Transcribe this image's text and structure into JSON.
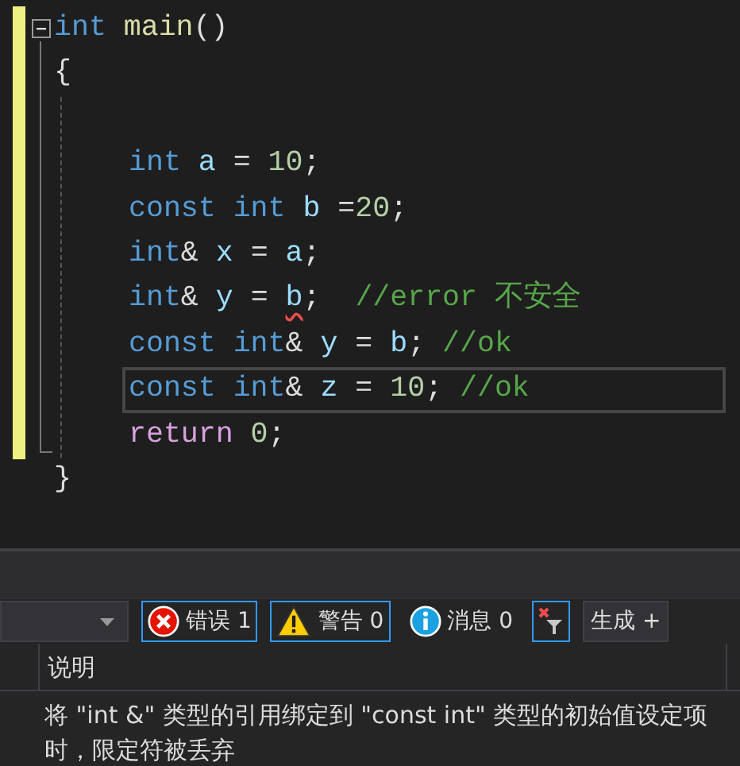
{
  "editor": {
    "lines": [
      {
        "kind": "code",
        "collapsible": true,
        "current": false,
        "tokens": [
          {
            "kind": "keyword",
            "text": "int"
          },
          {
            "kind": "function",
            "text": " main"
          },
          {
            "kind": "plain",
            "text": "()"
          }
        ]
      },
      {
        "kind": "code",
        "collapsible": false,
        "current": false,
        "tokens": [
          {
            "kind": "plain",
            "text": "{"
          }
        ],
        "children": [
          {
            "kind": "blank"
          },
          {
            "kind": "code",
            "collapsible": false,
            "current": false,
            "tokens": [
              {
                "kind": "keyword",
                "text": "int"
              },
              {
                "kind": "identifier",
                "text": " a"
              },
              {
                "kind": "plain",
                "text": " = "
              },
              {
                "kind": "number",
                "text": "10"
              },
              {
                "kind": "plain",
                "text": ";"
              }
            ]
          },
          {
            "kind": "code",
            "collapsible": false,
            "current": false,
            "tokens": [
              {
                "kind": "keyword",
                "text": "const int"
              },
              {
                "kind": "identifier",
                "text": " b"
              },
              {
                "kind": "plain",
                "text": " ="
              },
              {
                "kind": "number",
                "text": "20"
              },
              {
                "kind": "plain",
                "text": ";"
              }
            ]
          },
          {
            "kind": "code",
            "collapsible": false,
            "current": false,
            "tokens": [
              {
                "kind": "keyword",
                "text": "int"
              },
              {
                "kind": "plain",
                "text": "& "
              },
              {
                "kind": "identifier",
                "text": "x"
              },
              {
                "kind": "plain",
                "text": " = "
              },
              {
                "kind": "identifier",
                "text": "a"
              },
              {
                "kind": "plain",
                "text": ";"
              }
            ]
          },
          {
            "kind": "code",
            "collapsible": false,
            "current": false,
            "tokens": [
              {
                "kind": "keyword",
                "text": "int"
              },
              {
                "kind": "plain",
                "text": "& "
              },
              {
                "kind": "identifier",
                "text": "y"
              },
              {
                "kind": "plain",
                "text": " = "
              },
              {
                "kind": "identifier",
                "text": "b",
                "error": true
              },
              {
                "kind": "plain",
                "text": ";  "
              },
              {
                "kind": "comment",
                "text": "//error 不安全"
              }
            ]
          },
          {
            "kind": "code",
            "collapsible": false,
            "current": false,
            "tokens": [
              {
                "kind": "keyword",
                "text": "const int"
              },
              {
                "kind": "plain",
                "text": "& "
              },
              {
                "kind": "identifier",
                "text": "y"
              },
              {
                "kind": "plain",
                "text": " = "
              },
              {
                "kind": "identifier",
                "text": "b"
              },
              {
                "kind": "plain",
                "text": "; "
              },
              {
                "kind": "comment",
                "text": "//ok"
              }
            ]
          },
          {
            "kind": "code",
            "collapsible": false,
            "current": true,
            "tokens": [
              {
                "kind": "keyword",
                "text": "const int"
              },
              {
                "kind": "plain",
                "text": "& "
              },
              {
                "kind": "identifier",
                "text": "z"
              },
              {
                "kind": "plain",
                "text": " = "
              },
              {
                "kind": "number",
                "text": "10"
              },
              {
                "kind": "plain",
                "text": "; "
              },
              {
                "kind": "comment",
                "text": "//ok"
              }
            ]
          },
          {
            "kind": "code",
            "collapsible": false,
            "current": false,
            "tokens": [
              {
                "kind": "control",
                "text": "return"
              },
              {
                "kind": "number",
                "text": " 0"
              },
              {
                "kind": "plain",
                "text": ";"
              }
            ]
          }
        ]
      },
      {
        "kind": "code",
        "collapsible": false,
        "current": false,
        "tokens": [
          {
            "kind": "plain",
            "text": "}"
          }
        ]
      }
    ]
  },
  "error_list": {
    "filters": [
      {
        "kind": "error",
        "label": "错误 1",
        "selected": true
      },
      {
        "kind": "warning",
        "label": "警告 0",
        "selected": true
      },
      {
        "kind": "info",
        "label": "消息 0",
        "selected": false
      }
    ],
    "clear_filter": {
      "selected": true
    },
    "source_dropdown": {
      "value": "生成 +"
    },
    "columns": [
      "说明"
    ],
    "rows": [
      {
        "description": "将 \"int &\" 类型的引用绑定到 \"const int\" 类型的初始值设定项时，限定符被丢弃"
      }
    ]
  }
}
